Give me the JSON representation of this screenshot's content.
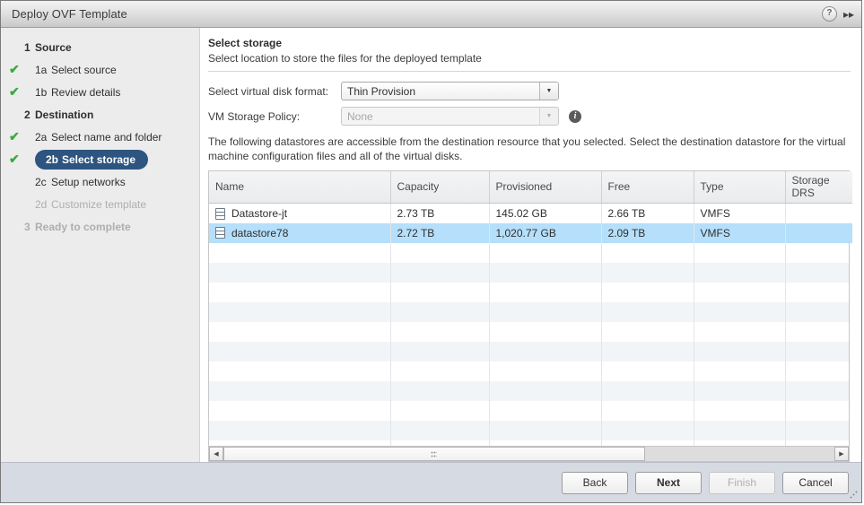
{
  "window": {
    "title": "Deploy OVF Template",
    "help_icon": "question-mark-circle-icon",
    "collapse_icon": "double-chevron-right-icon"
  },
  "sidebar": {
    "items": [
      {
        "num": "1",
        "label": "Source",
        "state": "group",
        "check": ""
      },
      {
        "num": "1a",
        "label": "Select source",
        "state": "done",
        "check": "✔"
      },
      {
        "num": "1b",
        "label": "Review details",
        "state": "done",
        "check": "✔"
      },
      {
        "num": "2",
        "label": "Destination",
        "state": "group",
        "check": ""
      },
      {
        "num": "2a",
        "label": "Select name and folder",
        "state": "done",
        "check": "✔"
      },
      {
        "num": "2b",
        "label": "Select storage",
        "state": "current",
        "check": "✔"
      },
      {
        "num": "2c",
        "label": "Setup networks",
        "state": "pending",
        "check": ""
      },
      {
        "num": "2d",
        "label": "Customize template",
        "state": "disabled",
        "check": ""
      },
      {
        "num": "3",
        "label": "Ready to complete",
        "state": "disabled-group",
        "check": ""
      }
    ]
  },
  "main": {
    "title": "Select storage",
    "subtitle": "Select location to store the files for the deployed template",
    "description": "The following datastores are accessible from the destination resource that you selected. Select the destination datastore for the virtual machine configuration files and all of the virtual disks.",
    "form": {
      "disk_format_label": "Select virtual disk format:",
      "disk_format_value": "Thin Provision",
      "storage_policy_label": "VM Storage Policy:",
      "storage_policy_value": "None",
      "info_icon": "info-circle-icon"
    },
    "table": {
      "columns": [
        "Name",
        "Capacity",
        "Provisioned",
        "Free",
        "Type",
        "Storage DRS"
      ],
      "rows": [
        {
          "name": "Datastore-jt",
          "capacity": "2.73 TB",
          "provisioned": "145.02 GB",
          "free": "2.66 TB",
          "type": "VMFS",
          "drs": "",
          "selected": false
        },
        {
          "name": "datastore78",
          "capacity": "2.72 TB",
          "provisioned": "1,020.77 GB",
          "free": "2.09 TB",
          "type": "VMFS",
          "drs": "",
          "selected": true
        }
      ],
      "empty_row_count": 11
    },
    "scrollbar": {
      "left_arrow": "◀",
      "right_arrow": "▶"
    }
  },
  "footer": {
    "buttons": [
      {
        "label": "Back",
        "style": "normal",
        "name": "back-button"
      },
      {
        "label": "Next",
        "style": "primary",
        "name": "next-button"
      },
      {
        "label": "Finish",
        "style": "disabled",
        "name": "finish-button"
      },
      {
        "label": "Cancel",
        "style": "normal",
        "name": "cancel-button"
      }
    ]
  },
  "colors": {
    "selection": "#b5dffa",
    "current_step": "#2d5580",
    "check": "#3aab3a",
    "footer": "#d6dae2"
  }
}
